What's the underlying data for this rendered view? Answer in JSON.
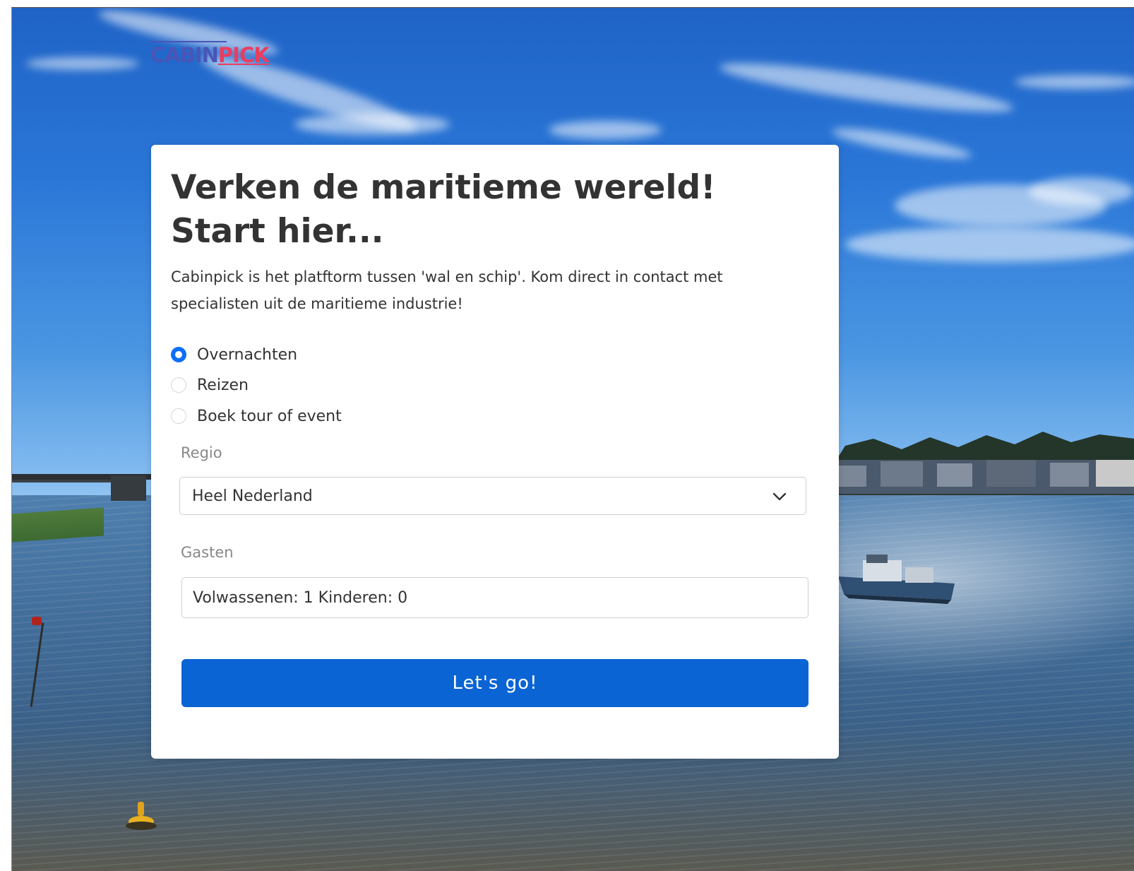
{
  "logo": {
    "part_one": "CABIN",
    "part_two": "PICK"
  },
  "card": {
    "title": "Verken de maritieme wereld! Start hier...",
    "intro": "Cabinpick is het platftorm tussen 'wal en schip'.  Kom direct in contact met specialisten uit de maritieme industrie!"
  },
  "options": [
    {
      "label": "Overnachten",
      "checked": true
    },
    {
      "label": "Reizen",
      "checked": false
    },
    {
      "label": "Boek tour of event",
      "checked": false
    }
  ],
  "region": {
    "label": "Regio",
    "value": "Heel Nederland",
    "icon": "chevron-down-icon"
  },
  "guests": {
    "label": "Gasten",
    "value": "Volwassenen: 1 Kinderen: 0"
  },
  "submit": {
    "label": "Let's go!"
  },
  "colors": {
    "accent": "#0a64d4",
    "radio_checked": "#0d6efd",
    "logo_blue": "#4a55b8",
    "logo_pink": "#ea3e5e"
  }
}
